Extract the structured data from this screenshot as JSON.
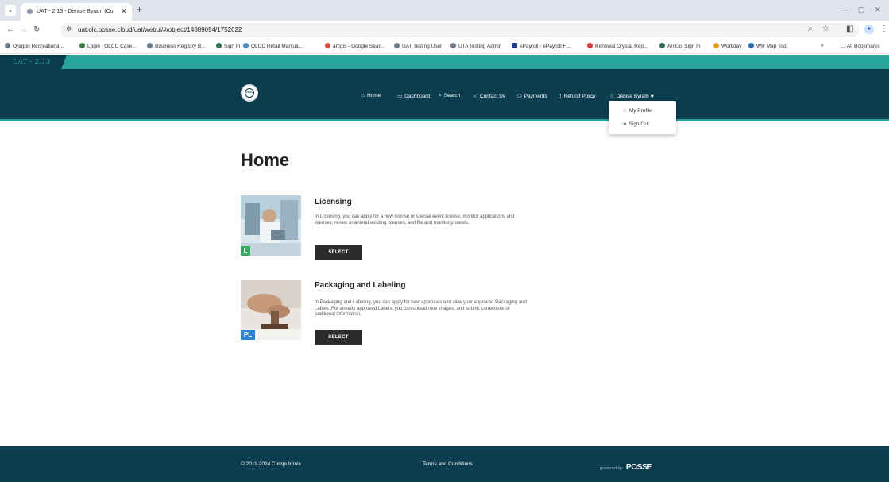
{
  "browser": {
    "tab_title": "UAT - 2.13 - Denise Byram (Cu",
    "url": "uat.olc.posse.cloud/uat/webui/#/object/14889094/1752622",
    "bookmarks": [
      "Oregon Recreationa...",
      "Login | OLCC Case...",
      "Business Registry B...",
      "Sign In",
      "OLCC Retail Marijua...",
      "arcgis - Google Sear...",
      "UAT Testing User",
      "UTA Testing Admin",
      "ePayroll - ePayroll H...",
      "Renewal Crystal Rep...",
      "ArcGis Sign In",
      "Workday",
      "WR Map Tool"
    ],
    "all_bookmarks": "All Bookmarks",
    "overflow": "»"
  },
  "env": {
    "tag": "UAT - 2.13"
  },
  "header": {
    "logo_text": "OLCC",
    "nav": {
      "home": "Home",
      "dashboard": "Dashboard",
      "search": "Search",
      "contact": "Contact Us",
      "payments": "Payments",
      "refund": "Refund Policy",
      "user": "Denise Byram"
    }
  },
  "dropdown": {
    "profile": "My Profile",
    "signout": "Sign Out"
  },
  "main": {
    "title": "Home",
    "cards": [
      {
        "title": "Licensing",
        "badge": "L",
        "badge_color": "#3aa860",
        "desc": "In Licensing, you can apply for a new license or special event license, monitor applications and licenses, renew or amend existing licenses, and file and monitor protests.",
        "button": "SELECT"
      },
      {
        "title": "Packaging and Labeling",
        "badge": "PL",
        "badge_color": "#2b86d9",
        "desc": "In Packaging and Labeling, you can apply for new approvals and view your approved Packaging and Labels. For already approved Labels, you can upload new images, and submit corrections or additional information.",
        "button": "SELECT"
      }
    ]
  },
  "footer": {
    "copyright": "© 2011-2024 Computronix",
    "terms": "Terms and Conditions",
    "powered_by": "powered by",
    "brand": "POSSE"
  },
  "colors": {
    "header": "#0c3d4e",
    "accent": "#27a59a",
    "button": "#2b2b2b"
  }
}
